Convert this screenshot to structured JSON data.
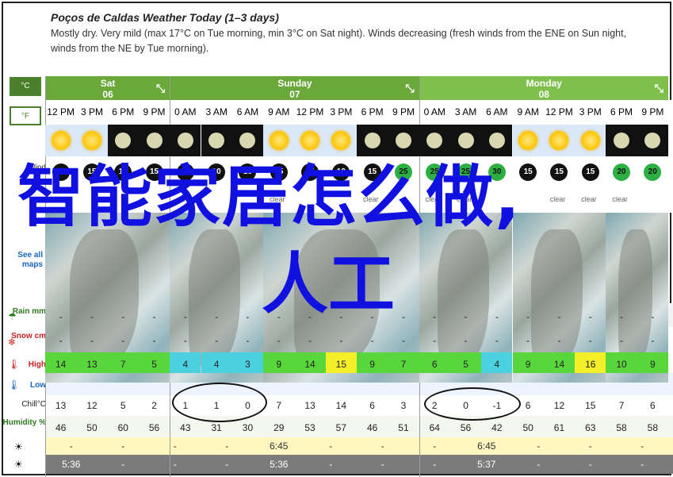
{
  "summary": {
    "title": "Poços de Caldas Weather Today (1–3 days)",
    "line1": "Mostly dry. Very mild (max 17°C on Tue morning, min 3°C on Sat night). Winds decreasing (fresh winds from the ENE on Sun night,",
    "line2": "winds from the NE by Tue morning)."
  },
  "units": {
    "celsius": "°C",
    "fahrenheit": "°F"
  },
  "side_labels": {
    "wind": "Wind",
    "see_all_maps": "See all maps",
    "rain": "Rain mm",
    "snow": "Snow cm",
    "high": "High",
    "low": "Low",
    "chill": "Chill°C",
    "humidity": "Humidity %"
  },
  "days": [
    {
      "name": "Sat",
      "date": "06",
      "color": "#6aa83a"
    },
    {
      "name": "Sunday",
      "date": "07",
      "color": "#6aa83a"
    },
    {
      "name": "Monday",
      "date": "08",
      "color": "#7fbf4c"
    }
  ],
  "times": [
    "12 PM",
    "3 PM",
    "6 PM",
    "9 PM",
    "0 AM",
    "3 AM",
    "6 AM",
    "9 AM",
    "12 PM",
    "3 PM",
    "6 PM",
    "9 PM",
    "0 AM",
    "3 AM",
    "6 AM",
    "9 AM",
    "12 PM",
    "3 PM",
    "6 PM",
    "9 PM"
  ],
  "sky": [
    "sun",
    "sun",
    "moon",
    "moon",
    "moon",
    "moon",
    "moon",
    "sun",
    "sun",
    "sun",
    "moon",
    "moon",
    "moon",
    "moon",
    "moon",
    "sun",
    "sun",
    "sun",
    "moon",
    "moon"
  ],
  "wind": [
    "10",
    "15",
    "15",
    "15",
    "10",
    "10",
    "10",
    "15",
    "15",
    "10",
    "15",
    "25",
    "25",
    "25",
    "30",
    "15",
    "15",
    "15",
    "20",
    "20"
  ],
  "wind_green": [
    false,
    false,
    false,
    false,
    false,
    false,
    false,
    false,
    false,
    false,
    false,
    true,
    true,
    true,
    true,
    false,
    false,
    false,
    true,
    true
  ],
  "conditions_visible": [
    "clear",
    "clear",
    "clear",
    "clear",
    "clear",
    "clear",
    "clear",
    "clear"
  ],
  "rain": [
    "-",
    "-",
    "-",
    "-",
    "-",
    "-",
    "-",
    "-",
    "-",
    "-",
    "-",
    "-",
    "-",
    "-",
    "-",
    "-",
    "-",
    "-",
    "-",
    "-"
  ],
  "snow": [
    "-",
    "-",
    "-",
    "-",
    "-",
    "-",
    "-",
    "-",
    "-",
    "-",
    "-",
    "-",
    "-",
    "-",
    "-",
    "-",
    "-",
    "-",
    "-",
    "-"
  ],
  "high": [
    "14",
    "13",
    "7",
    "5",
    "4",
    "4",
    "3",
    "9",
    "14",
    "15",
    "9",
    "7",
    "6",
    "5",
    "4",
    "9",
    "14",
    "16",
    "10",
    "9"
  ],
  "high_colors": [
    "#58d63b",
    "#58d63b",
    "#58d63b",
    "#58d63b",
    "#4bd0e0",
    "#4bd0e0",
    "#4bd0e0",
    "#58d63b",
    "#58d63b",
    "#f5ef2a",
    "#58d63b",
    "#58d63b",
    "#58d63b",
    "#58d63b",
    "#4bd0e0",
    "#58d63b",
    "#58d63b",
    "#f5ef2a",
    "#58d63b",
    "#58d63b"
  ],
  "low": [
    "",
    "",
    "",
    "",
    "",
    "",
    "",
    "",
    "",
    "",
    "",
    "",
    "",
    "",
    "",
    "",
    "",
    "",
    "",
    ""
  ],
  "chill": [
    "13",
    "12",
    "5",
    "2",
    "1",
    "1",
    "0",
    "7",
    "13",
    "14",
    "6",
    "3",
    "2",
    "0",
    "-1",
    "6",
    "12",
    "15",
    "7",
    "6"
  ],
  "humidity": [
    "46",
    "50",
    "60",
    "56",
    "43",
    "31",
    "30",
    "29",
    "53",
    "57",
    "46",
    "51",
    "64",
    "56",
    "42",
    "50",
    "61",
    "63",
    "58",
    "58"
  ],
  "sunrise": [
    "-",
    "-",
    "-",
    "-",
    "6:45",
    "-",
    "-",
    "-",
    "6:45",
    "-",
    "-",
    "-"
  ],
  "sunset": [
    "5:36",
    "-",
    "-",
    "-",
    "5:36",
    "-",
    "-",
    "-",
    "5:37",
    "-",
    "-",
    "-"
  ],
  "overlay": {
    "line1": "智能家居怎么做,",
    "line2": "人工"
  }
}
